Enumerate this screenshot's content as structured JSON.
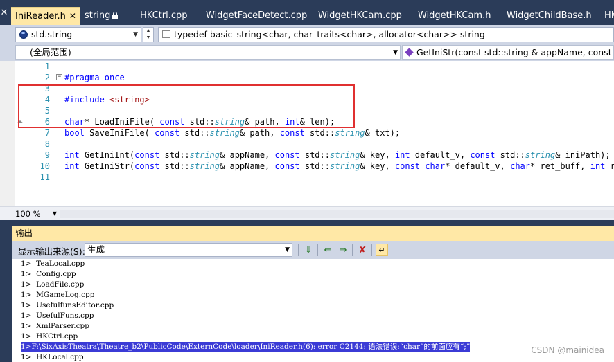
{
  "tabs": [
    {
      "label": "IniReader.h",
      "active": true
    },
    {
      "label": "string",
      "locked": true
    },
    {
      "label": "HKCtrl.cpp"
    },
    {
      "label": "WidgetFaceDetect.cpp"
    },
    {
      "label": "WidgetHKCam.cpp"
    },
    {
      "label": "WidgetHKCam.h"
    },
    {
      "label": "WidgetChildBase.h"
    },
    {
      "label": "HK"
    }
  ],
  "nav1": {
    "scope": "std.string",
    "typedef": "typedef basic_string<char, char_traits<char>, allocator<char>> string"
  },
  "nav2": {
    "scope": "(全局范围)",
    "member": "GetIniStr(const std::string & appName, const std::"
  },
  "editor": {
    "lines": [
      {
        "n": "1",
        "html": ""
      },
      {
        "n": "2",
        "html": "<span class=\"pp\">#pragma once</span>"
      },
      {
        "n": "3",
        "html": ""
      },
      {
        "n": "4",
        "html": "<span class=\"pp\">#include</span> <span class=\"str\">&lt;string&gt;</span>"
      },
      {
        "n": "5",
        "html": ""
      },
      {
        "n": "6",
        "html": "<span class=\"kw\">char</span>* LoadIniFile( <span class=\"kw\">const</span> std::<span class=\"ty\">string</span>&amp; path, <span class=\"kw\">int</span>&amp; len);"
      },
      {
        "n": "7",
        "html": "<span class=\"kw\">bool</span> SaveIniFile( <span class=\"kw\">const</span> std::<span class=\"ty\">string</span>&amp; path, <span class=\"kw\">const</span> std::<span class=\"ty\">string</span>&amp; txt);"
      },
      {
        "n": "8",
        "html": ""
      },
      {
        "n": "9",
        "html": "<span class=\"kw\">int</span> GetIniInt(<span class=\"kw\">const</span> std::<span class=\"ty\">string</span>&amp; appName, <span class=\"kw\">const</span> std::<span class=\"ty\">string</span>&amp; key, <span class=\"kw\">int</span> default_v, <span class=\"kw\">const</span> std::<span class=\"ty\">string</span>&amp; iniPath);"
      },
      {
        "n": "10",
        "html": "<span class=\"kw\">int</span> GetIniStr(<span class=\"kw\">const</span> std::<span class=\"ty\">string</span>&amp; appName, <span class=\"kw\">const</span> std::<span class=\"ty\">string</span>&amp; key, <span class=\"kw\">const</span> <span class=\"kw\">char</span>* default_v, <span class=\"kw\">char</span>* ret_buff, <span class=\"kw\">int</span> ret_l"
      },
      {
        "n": "11",
        "html": ""
      }
    ],
    "zoom": "100 %"
  },
  "output": {
    "title": "输出",
    "source_label": "显示输出来源(S):",
    "source_value": "生成",
    "lines": [
      "1>  TeaLocal.cpp",
      "1>  Config.cpp",
      "1>  LoadFile.cpp",
      "1>  MGameLog.cpp",
      "1>  UsefulfunsEditor.cpp",
      "1>  UsefulFuns.cpp",
      "1>  XmlParser.cpp",
      "1>  HKCtrl.cpp",
      "1>F:\\SixAxisTheatra\\Theatre_b2\\PublicCode\\ExternCode\\loader\\IniReader.h(6): error C2144: 语法错误:“char”的前面应有“;”",
      "1>  HKLocal.cpp"
    ],
    "selected_index": 8
  },
  "watermark": "CSDN @mainidea",
  "icons": {
    "scope_icon": "globe-icon",
    "member_icon": "method-icon"
  }
}
